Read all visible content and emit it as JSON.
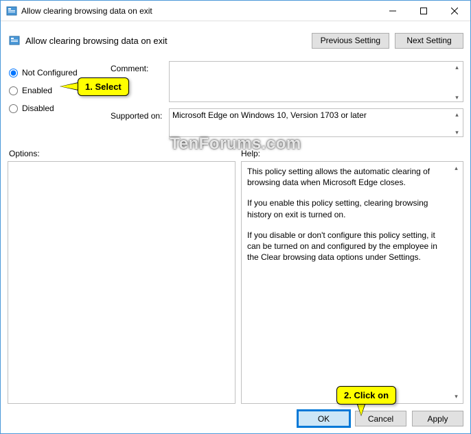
{
  "titlebar": {
    "title": "Allow clearing browsing data on exit"
  },
  "header": {
    "title": "Allow clearing browsing data on exit"
  },
  "nav": {
    "prev": "Previous Setting",
    "next": "Next Setting"
  },
  "radios": {
    "not_configured": "Not Configured",
    "enabled": "Enabled",
    "disabled": "Disabled"
  },
  "labels": {
    "comment": "Comment:",
    "supported": "Supported on:",
    "options": "Options:",
    "help": "Help:"
  },
  "fields": {
    "comment": "",
    "supported": "Microsoft Edge on Windows 10, Version 1703 or later"
  },
  "help": {
    "p1": "This policy setting allows the automatic clearing of browsing data when Microsoft Edge closes.",
    "p2": "If you enable this policy setting, clearing browsing history on exit is turned on.",
    "p3": "If you disable or don't configure this policy setting, it can be turned on and configured by the employee in the Clear browsing data options under Settings."
  },
  "buttons": {
    "ok": "OK",
    "cancel": "Cancel",
    "apply": "Apply"
  },
  "callouts": {
    "c1": "1. Select",
    "c2": "2. Click on"
  },
  "watermark": "TenForums.com"
}
